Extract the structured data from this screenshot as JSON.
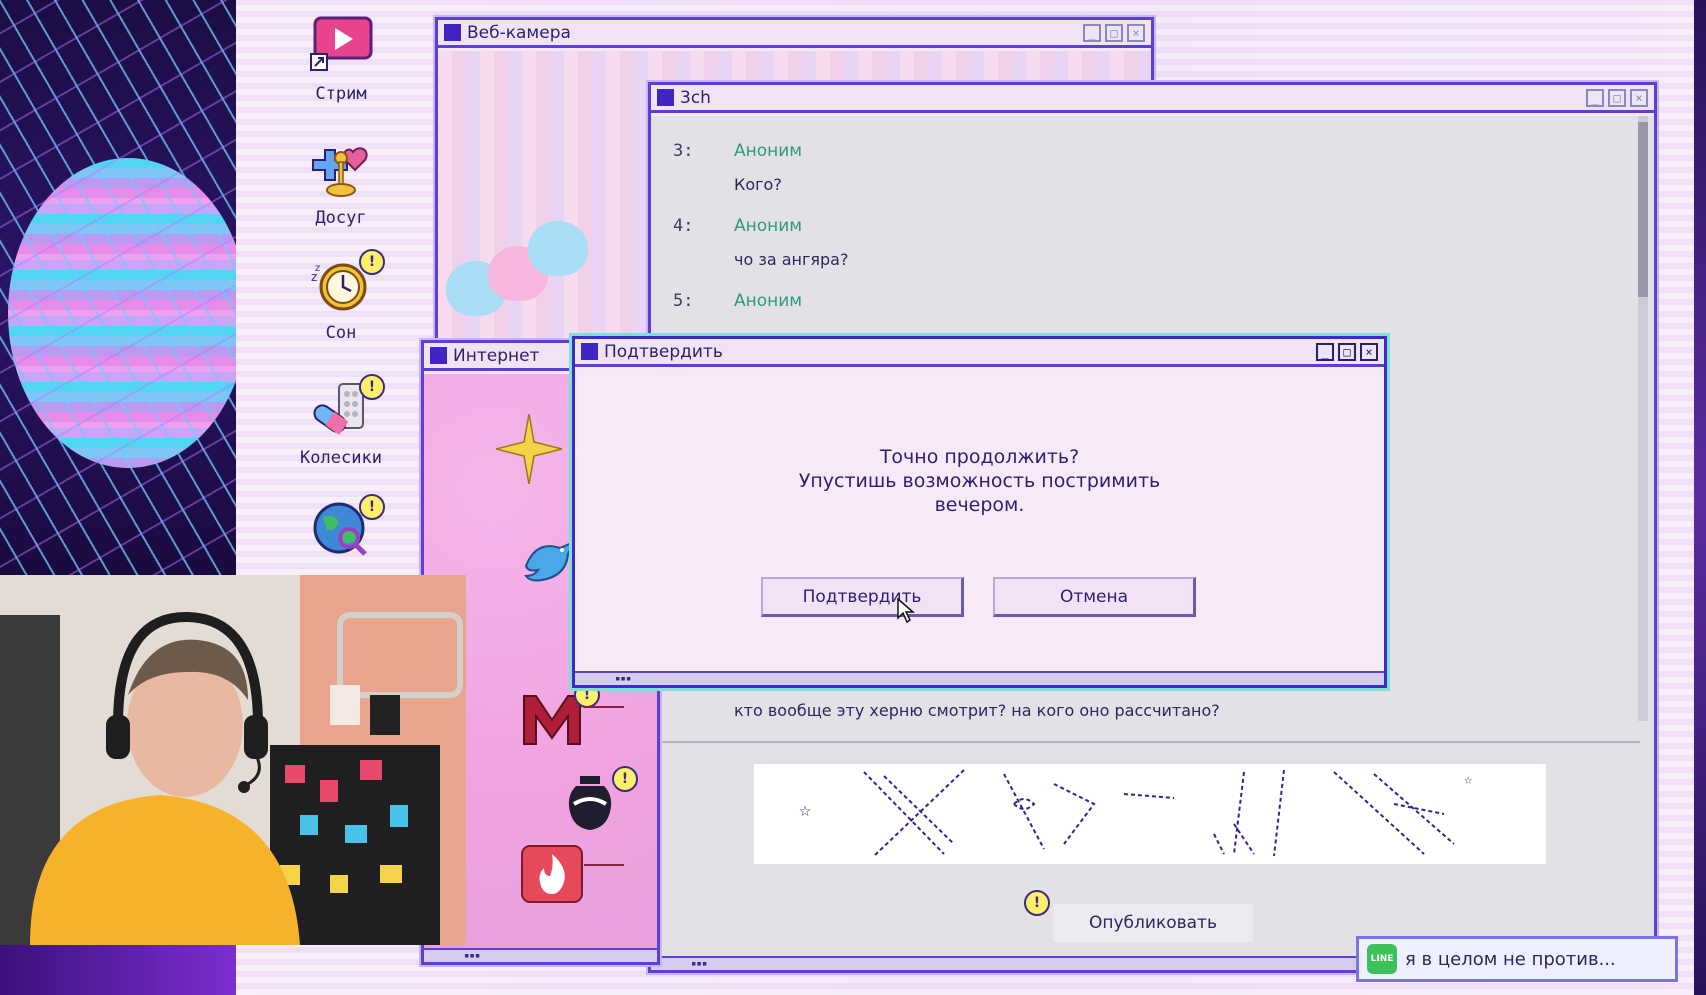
{
  "desktop": {
    "icons": [
      {
        "label": "Стрим"
      },
      {
        "label": "Досуг"
      },
      {
        "label": "Сон"
      },
      {
        "label": "Колесики"
      },
      {
        "label": ""
      }
    ]
  },
  "windows": {
    "webcam": {
      "title": "Веб-камера"
    },
    "board": {
      "title": "3ch",
      "posts": [
        {
          "num": "3:",
          "name": "Аноним",
          "text": "Кого?"
        },
        {
          "num": "4:",
          "name": "Аноним",
          "text": "чо за ангяра?"
        },
        {
          "num": "5:",
          "name": "Аноним",
          "text": ""
        }
      ],
      "last_post_text": "кто вообще эту херню смотрит? на кого оно рассчитано?",
      "publish_label": "Опубликовать"
    },
    "internet": {
      "title": "Интернет"
    },
    "confirm": {
      "title": "Подтвердить",
      "message_line1": "Точно продолжить?",
      "message_line2": "Упустишь возможность постримить",
      "message_line3": "вечером.",
      "confirm_label": "Подтвердить",
      "cancel_label": "Отмена"
    }
  },
  "toast": {
    "text": "я в целом не против..."
  },
  "badge_glyph": "!",
  "window_controls": {
    "minimize": "_",
    "maximize": "□",
    "close": "×"
  },
  "colors": {
    "accent": "#5b3fd6",
    "title_square": "#4125c4",
    "name": "#2a9a7e"
  }
}
